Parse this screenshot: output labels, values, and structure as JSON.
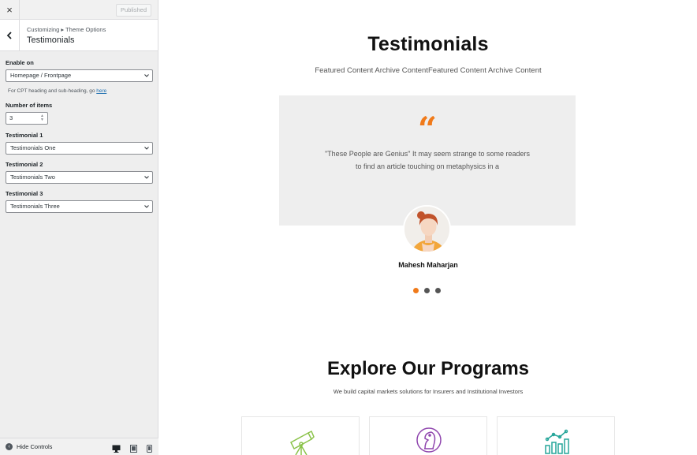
{
  "topbar": {
    "close_icon": "×",
    "published_label": "Published"
  },
  "section": {
    "breadcrumb": "Customizing ▸ Theme Options",
    "title": "Testimonials"
  },
  "controls": {
    "enable_on": {
      "label": "Enable on",
      "value": "Homepage / Frontpage"
    },
    "help_text": "For CPT heading and sub-heading, go ",
    "help_link": "here",
    "num_items": {
      "label": "Number of items",
      "value": "3"
    },
    "testimonials": [
      {
        "label": "Testimonial 1",
        "value": "Testimonials One"
      },
      {
        "label": "Testimonial 2",
        "value": "Testimonials Two"
      },
      {
        "label": "Testimonial 3",
        "value": "Testimonials Three"
      }
    ]
  },
  "footer": {
    "hide_controls": "Hide Controls"
  },
  "preview": {
    "testimonials_title": "Testimonials",
    "testimonials_sub": "Featured Content Archive ContentFeatured Content Archive Content",
    "quote_mark": "“",
    "quote_line1": "\"These People are Genius\" It may seem strange to some readers",
    "quote_line2": "to find an article touching on metaphysics in a",
    "author": "Mahesh Maharjan",
    "active_dot": 0,
    "programs_title": "Explore Our Programs",
    "programs_sub": "We build capital markets solutions for Insurers and Institutional Investors",
    "program_icons": [
      "telescope-icon",
      "chess-knight-icon",
      "bar-chart-icon"
    ],
    "colors": {
      "accent": "#f07a1a",
      "icon_green": "#8bc34a",
      "icon_purple": "#8e44ad",
      "icon_teal": "#26a69a"
    }
  }
}
